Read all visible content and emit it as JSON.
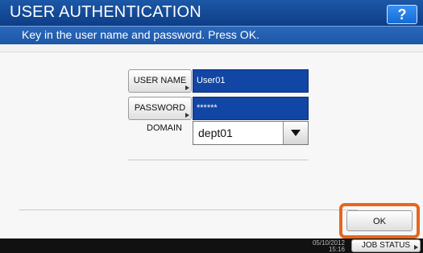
{
  "header": {
    "title": "USER AUTHENTICATION",
    "help_label": "?"
  },
  "instruction": "Key in the user name and password. Press OK.",
  "form": {
    "user_name_button": "USER NAME",
    "user_name_value": "User01",
    "password_button": "PASSWORD",
    "password_value": "******",
    "domain_label": "DOMAIN",
    "domain_value": "dept01"
  },
  "actions": {
    "ok_label": "OK"
  },
  "status_bar": {
    "date": "05/10/2012",
    "time": "15:16",
    "job_status_label": "JOB STATUS"
  },
  "colors": {
    "title_bar": "#1c58a8",
    "input_fill": "#1246a5",
    "highlight": "#e5671f",
    "status_bar": "#111111"
  }
}
